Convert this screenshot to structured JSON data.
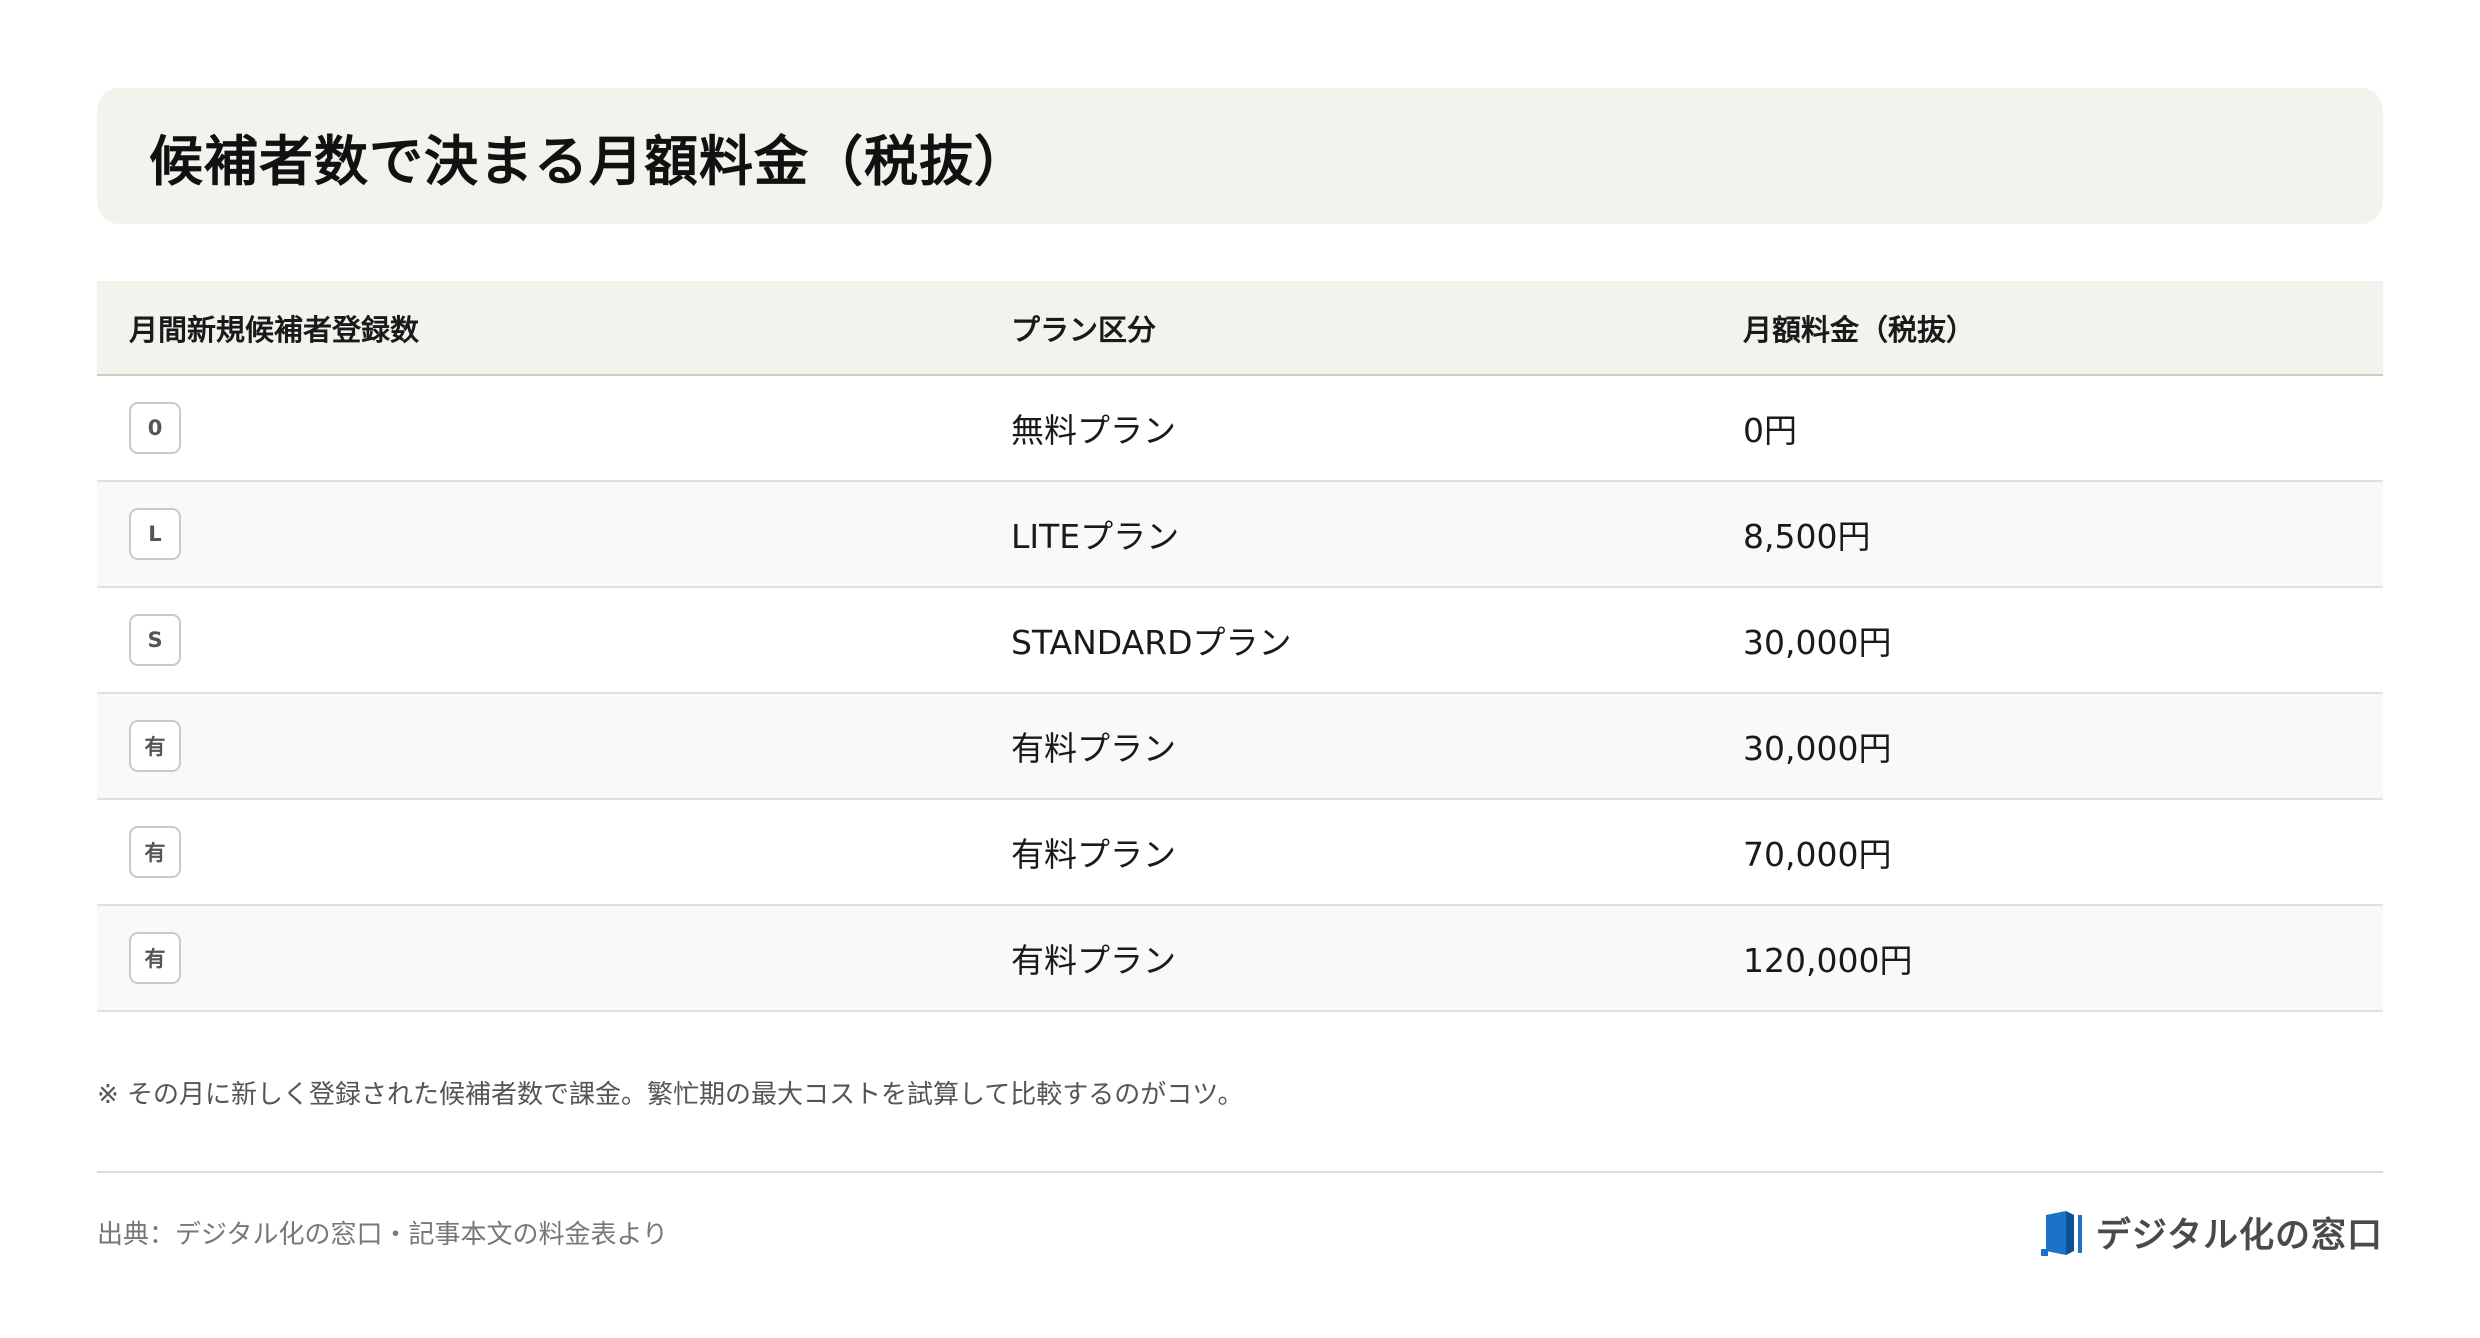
{
  "title": "候補者数で決まる月額料金（税抜）",
  "table": {
    "headers": [
      "月間新規候補者登録数",
      "プラン区分",
      "月額料金（税抜）"
    ],
    "rows": [
      {
        "badge": "0",
        "plan": "無料プラン",
        "price": "0円"
      },
      {
        "badge": "L",
        "plan": "LITEプラン",
        "price": "8,500円"
      },
      {
        "badge": "S",
        "plan": "STANDARDプラン",
        "price": "30,000円"
      },
      {
        "badge": "有",
        "plan": "有料プラン",
        "price": "30,000円"
      },
      {
        "badge": "有",
        "plan": "有料プラン",
        "price": "70,000円"
      },
      {
        "badge": "有",
        "plan": "有料プラン",
        "price": "120,000円"
      }
    ]
  },
  "note": "※ その月に新しく登録された候補者数で課金。繁忙期の最大コストを試算して比較するのがコツ。",
  "footer": {
    "source": "出典：デジタル化の窓口・記事本文の料金表より",
    "brand": "デジタル化の窓口",
    "brand_icon": "window-logo-icon",
    "brand_color": "#1a73c9"
  }
}
